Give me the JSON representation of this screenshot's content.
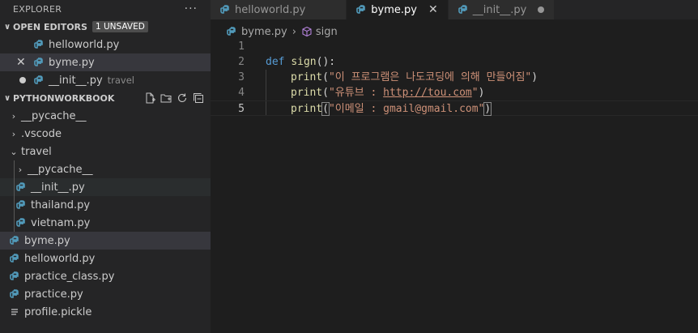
{
  "explorer": {
    "title": "EXPLORER",
    "more": "···",
    "open_editors": {
      "label": "OPEN EDITORS",
      "badge": "1 UNSAVED",
      "items": [
        {
          "name": "helloworld.py",
          "desc": ""
        },
        {
          "name": "byme.py",
          "desc": ""
        },
        {
          "name": "__init__.py",
          "desc": "travel"
        }
      ]
    },
    "workbook": {
      "label": "PYTHONWORKBOOK",
      "tree": [
        {
          "name": "__pycache__"
        },
        {
          "name": ".vscode"
        },
        {
          "name": "travel"
        },
        {
          "name": "__pycache__"
        },
        {
          "name": "__init__.py"
        },
        {
          "name": "thailand.py"
        },
        {
          "name": "vietnam.py"
        },
        {
          "name": "byme.py"
        },
        {
          "name": "helloworld.py"
        },
        {
          "name": "practice_class.py"
        },
        {
          "name": "practice.py"
        },
        {
          "name": "profile.pickle"
        }
      ]
    }
  },
  "tabs": [
    {
      "label": "helloworld.py"
    },
    {
      "label": "byme.py"
    },
    {
      "label": "__init__.py"
    }
  ],
  "breadcrumb": {
    "file": "byme.py",
    "symbol": "sign"
  },
  "code": {
    "line_numbers": [
      "1",
      "2",
      "3",
      "4",
      "5"
    ],
    "line2": {
      "kw": "def",
      "fn": "sign",
      "tail": "():"
    },
    "line3": {
      "fn": "print",
      "open": "(",
      "str": "\"이 프로그램은 나도코딩에 의해 만들어짐\"",
      "close": ")"
    },
    "line4": {
      "fn": "print",
      "open": "(",
      "str_a": "\"유튜브 : ",
      "url": "http://tou.com",
      "str_b": "\"",
      "close": ")"
    },
    "line5": {
      "fn": "print",
      "open": "(",
      "str": "\"이메일 : gmail@gmail.com\"",
      "close": ")"
    }
  },
  "colors": {
    "python_icon": "#519aba",
    "keyword": "#569cd6",
    "function": "#dcdcaa",
    "string": "#ce9178"
  }
}
